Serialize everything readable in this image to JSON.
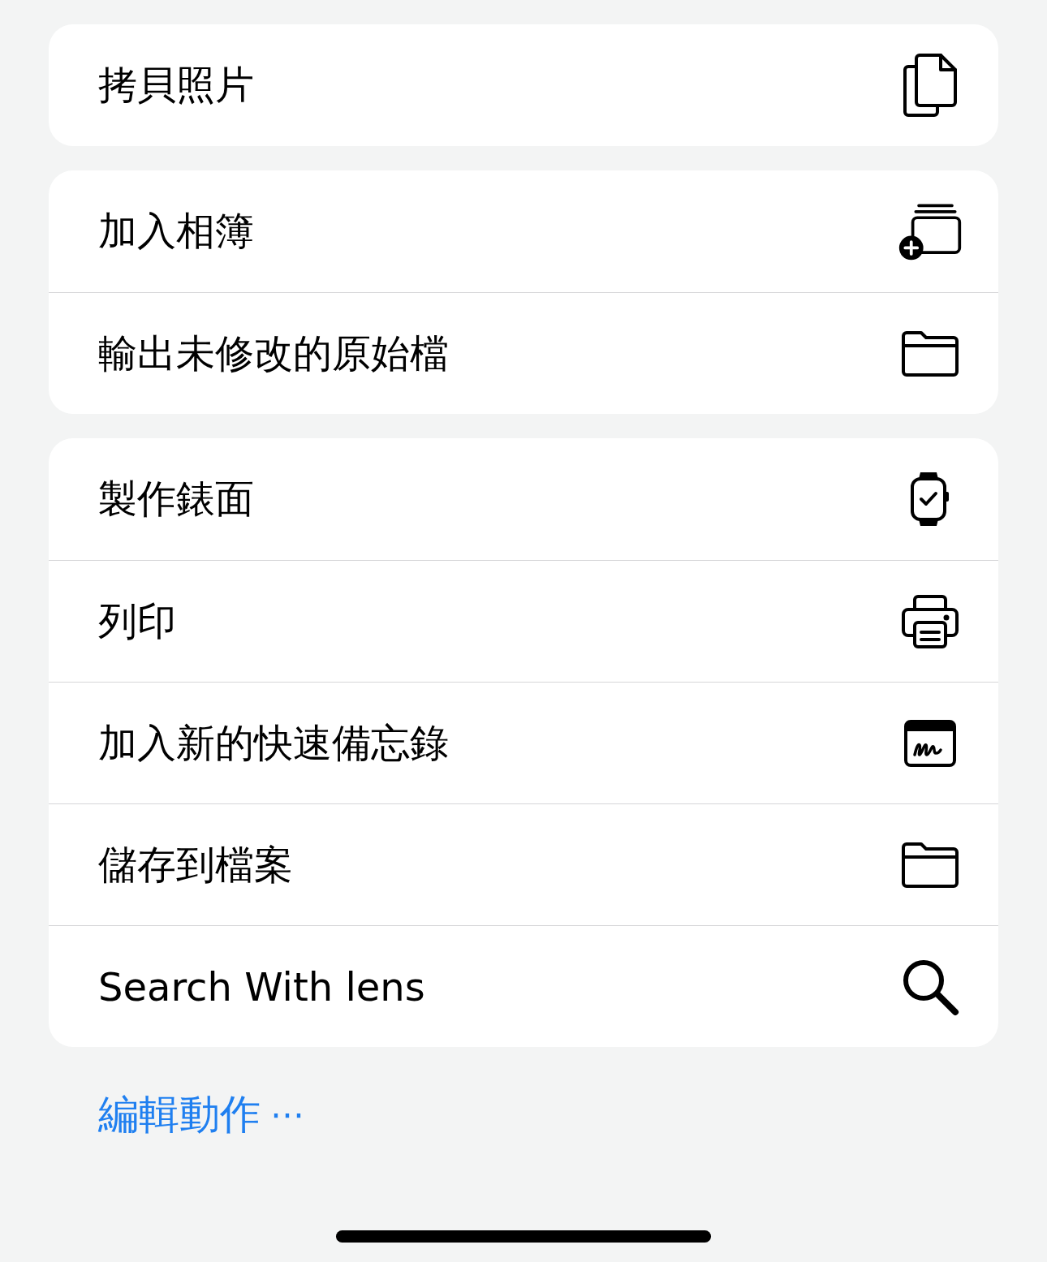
{
  "groups": [
    {
      "items": [
        {
          "label": "拷貝照片",
          "kind": "copy"
        }
      ]
    },
    {
      "items": [
        {
          "label": "加入相簿",
          "kind": "album"
        },
        {
          "label": "輸出未修改的原始檔",
          "kind": "folder"
        }
      ]
    },
    {
      "items": [
        {
          "label": "製作錶面",
          "kind": "watch"
        },
        {
          "label": "列印",
          "kind": "print"
        },
        {
          "label": "加入新的快速備忘錄",
          "kind": "note"
        },
        {
          "label": "儲存到檔案",
          "kind": "folder"
        },
        {
          "label": "Search With lens",
          "kind": "search"
        }
      ]
    }
  ],
  "edit_link": {
    "label": "編輯動作",
    "dots": "⋯"
  }
}
